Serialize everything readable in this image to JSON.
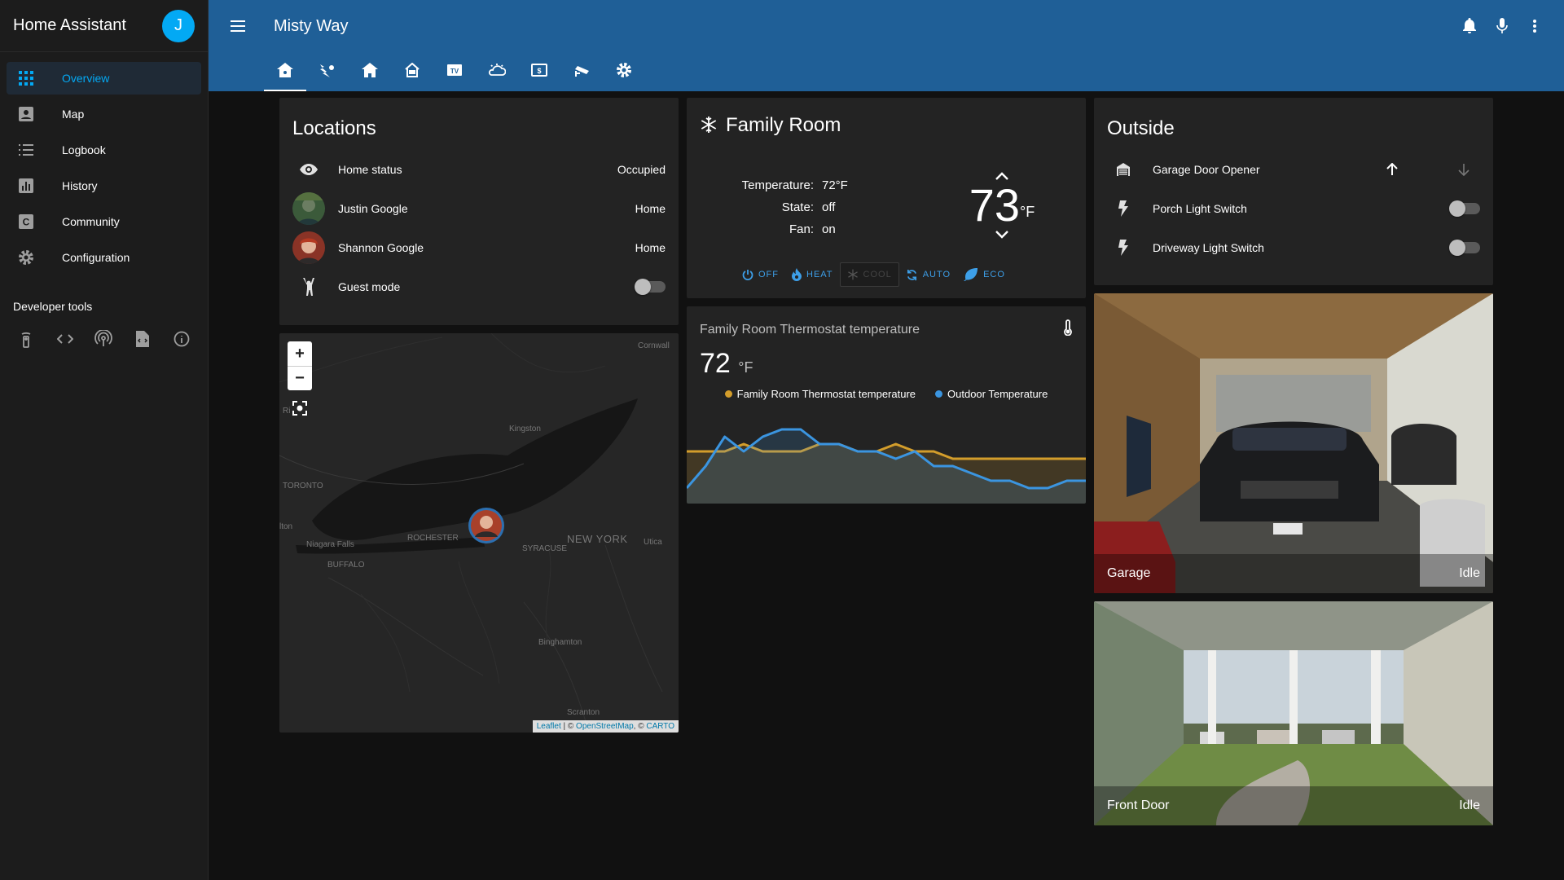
{
  "app": {
    "title": "Home Assistant",
    "user_initial": "J"
  },
  "sidebar": {
    "items": [
      {
        "label": "Overview",
        "icon": "grid-icon"
      },
      {
        "label": "Map",
        "icon": "account-box-icon"
      },
      {
        "label": "Logbook",
        "icon": "list-icon"
      },
      {
        "label": "History",
        "icon": "chart-icon"
      },
      {
        "label": "Community",
        "icon": "community-icon"
      },
      {
        "label": "Configuration",
        "icon": "gear-icon"
      }
    ],
    "developer_tools_label": "Developer tools",
    "developer_tools": [
      "remote-icon",
      "code-icon",
      "broadcast-icon",
      "file-code-icon",
      "info-icon"
    ]
  },
  "header": {
    "title": "Misty Way",
    "actions": [
      "bell-icon",
      "microphone-icon",
      "more-vert-icon"
    ]
  },
  "tabs": [
    "home-icon",
    "weather-icon",
    "house-icon",
    "house-outline-icon",
    "tv-icon",
    "weather-night-icon",
    "money-icon",
    "cctv-icon",
    "settings-icon"
  ],
  "locations": {
    "title": "Locations",
    "rows": [
      {
        "name": "Home status",
        "value": "Occupied"
      },
      {
        "name": "Justin Google",
        "value": "Home"
      },
      {
        "name": "Shannon Google",
        "value": "Home"
      },
      {
        "name": "Guest mode",
        "value": ""
      }
    ]
  },
  "map": {
    "labels": [
      "Cornwall",
      "Kingston",
      "TORONTO",
      "lton",
      "Niagara Falls",
      "BUFFALO",
      "ROCHESTER",
      "SYRACUSE",
      "NEW YORK",
      "Utica",
      "Binghamton",
      "Scranton",
      "Ri"
    ],
    "attribution": {
      "leaflet": "Leaflet",
      "sep1": " | © ",
      "osm": "OpenStreetMap",
      "sep2": ", © ",
      "carto": "CARTO"
    },
    "zoom_in": "+",
    "zoom_out": "−"
  },
  "thermostat": {
    "title": "Family Room",
    "temperature_label": "Temperature:",
    "temperature_value": "72°F",
    "state_label": "State:",
    "state_value": "off",
    "fan_label": "Fan:",
    "fan_value": "on",
    "target": "73",
    "unit": "°F",
    "modes": [
      "OFF",
      "HEAT",
      "COOL",
      "AUTO",
      "ECO"
    ]
  },
  "sensor": {
    "title": "Family Room Thermostat temperature",
    "value": "72",
    "unit": "°F",
    "legend": [
      {
        "name": "Family Room Thermostat temperature",
        "color": "#d39d2b"
      },
      {
        "name": "Outdoor Temperature",
        "color": "#3b95e0"
      }
    ]
  },
  "chart_data": {
    "type": "line",
    "series": [
      {
        "name": "Family Room Thermostat temperature",
        "values": [
          72,
          72,
          72,
          73,
          72,
          72,
          72,
          73,
          73,
          72,
          72,
          73,
          72,
          72,
          71,
          71,
          71,
          71,
          71,
          71,
          71,
          71
        ]
      },
      {
        "name": "Outdoor Temperature",
        "values": [
          67,
          70,
          74,
          72,
          74,
          75,
          75,
          73,
          73,
          72,
          72,
          71,
          72,
          70,
          70,
          69,
          68,
          68,
          67,
          67,
          68,
          68
        ]
      }
    ]
  },
  "outside": {
    "title": "Outside",
    "rows": [
      {
        "name": "Garage Door Opener"
      },
      {
        "name": "Porch Light Switch"
      },
      {
        "name": "Driveway Light Switch"
      }
    ]
  },
  "cameras": [
    {
      "name": "Garage",
      "state": "Idle"
    },
    {
      "name": "Front Door",
      "state": "Idle"
    }
  ]
}
